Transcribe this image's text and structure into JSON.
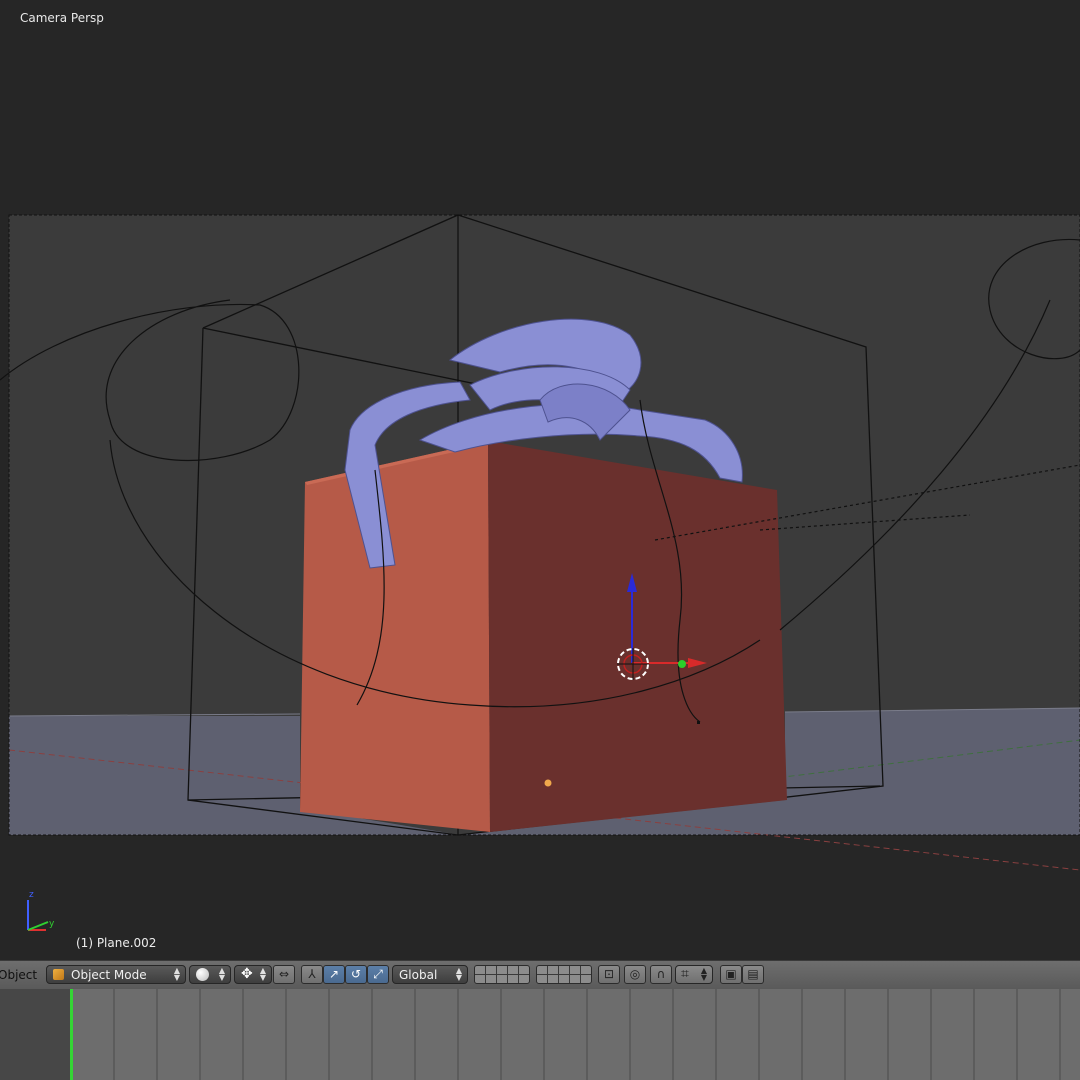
{
  "viewport": {
    "title": "Camera Persp",
    "object_label": "(1) Plane.002",
    "axes": {
      "z": "z",
      "y": "y"
    }
  },
  "header": {
    "menu_object": "Object",
    "mode_label": "Object Mode",
    "shading_icon": "solid-sphere-icon",
    "pivot_icon": "pivot-point-icon",
    "orientation_label": "Global",
    "snap_icon": "magnet-icon",
    "render_icon": "camera-icon",
    "anim_icon": "clapperboard-icon"
  },
  "colors": {
    "box_front": "#b65a48",
    "box_side": "#6a302d",
    "ribbon": "#8a8fd4",
    "floor": "#5e6070",
    "background": "#3b3b3b",
    "current_frame": "#35d635"
  }
}
